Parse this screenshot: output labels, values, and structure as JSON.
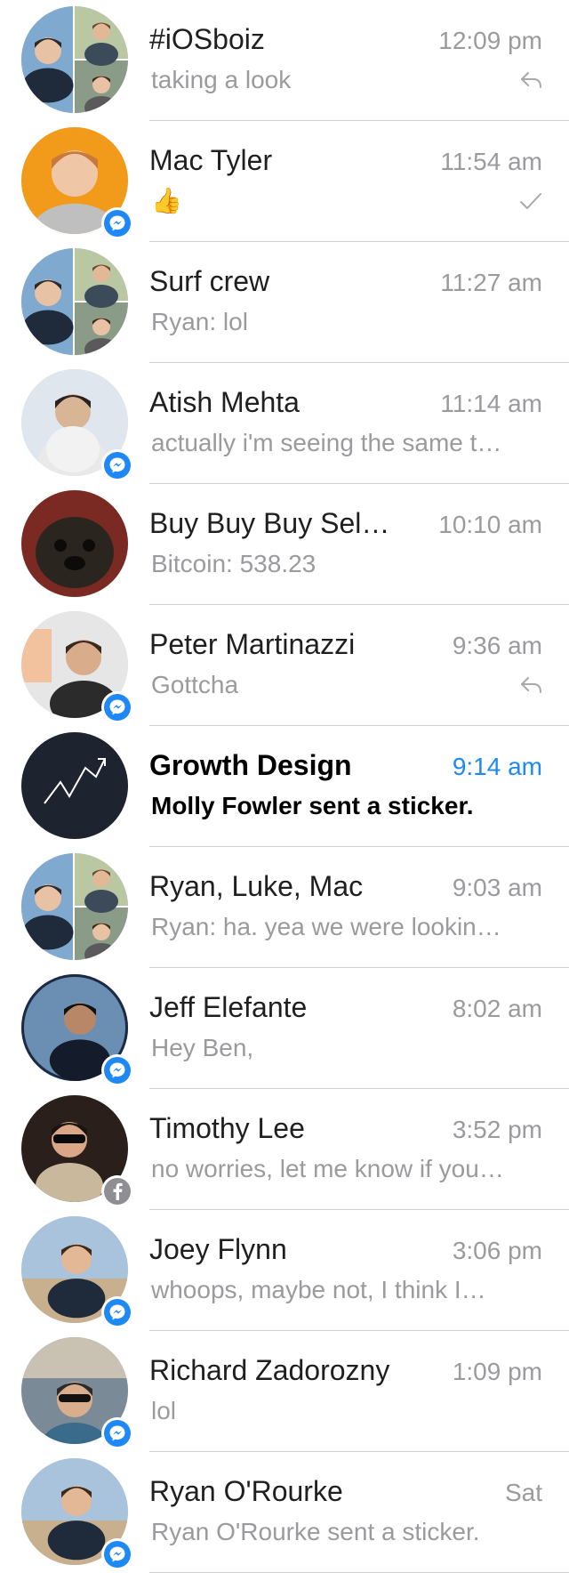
{
  "conversations": [
    {
      "name": "#iOSboiz",
      "time": "12:09 pm",
      "preview": "taking a look",
      "status_icon": "reply-icon",
      "badge": "none",
      "avatar": "group-photo"
    },
    {
      "name": "Mac Tyler",
      "time": "11:54 am",
      "preview": "👍",
      "status_icon": "checkmark-icon",
      "badge": "messenger",
      "avatar": "person-orange"
    },
    {
      "name": "Surf crew",
      "time": "11:27 am",
      "preview": "Ryan: lol",
      "status_icon": "none",
      "badge": "none",
      "avatar": "group-photo"
    },
    {
      "name": "Atish Mehta",
      "time": "11:14 am",
      "preview": "actually i'm seeing the same t…",
      "status_icon": "none",
      "badge": "messenger",
      "avatar": "person-light"
    },
    {
      "name": "Buy Buy Buy Sel…",
      "time": "10:10 am",
      "preview": "Bitcoin: 538.23",
      "status_icon": "none",
      "badge": "none",
      "avatar": "pug-photo"
    },
    {
      "name": "Peter Martinazzi",
      "time": "9:36 am",
      "preview": "Gottcha",
      "status_icon": "reply-icon",
      "badge": "messenger",
      "avatar": "person-grey"
    },
    {
      "name": "Growth Design",
      "time": "9:14 am",
      "preview": "Molly Fowler sent a sticker.",
      "status_icon": "none",
      "badge": "none",
      "avatar": "growth-logo",
      "unread": true
    },
    {
      "name": "Ryan, Luke, Mac",
      "time": "9:03 am",
      "preview": "Ryan: ha. yea we were lookin…",
      "status_icon": "none",
      "badge": "none",
      "avatar": "group-photo"
    },
    {
      "name": "Jeff Elefante",
      "time": "8:02 am",
      "preview": "Hey Ben,",
      "status_icon": "none",
      "badge": "messenger",
      "avatar": "person-car"
    },
    {
      "name": "Timothy Lee",
      "time": "3:52 pm",
      "preview": "no worries, let me know if you…",
      "status_icon": "none",
      "badge": "facebook",
      "avatar": "person-dark"
    },
    {
      "name": "Joey Flynn",
      "time": "3:06 pm",
      "preview": "whoops, maybe not, I think I…",
      "status_icon": "none",
      "badge": "messenger",
      "avatar": "person-beach"
    },
    {
      "name": "Richard Zadorozny",
      "time": "1:09 pm",
      "preview": "lol",
      "status_icon": "none",
      "badge": "messenger",
      "avatar": "person-upside"
    },
    {
      "name": "Ryan O'Rourke",
      "time": "Sat",
      "preview": "Ryan O'Rourke sent a sticker.",
      "status_icon": "none",
      "badge": "messenger",
      "avatar": "person-beach"
    }
  ],
  "colors": {
    "accent": "#1e88f5",
    "secondary_text": "#9a9a9f",
    "separator": "#cfcfd3"
  }
}
